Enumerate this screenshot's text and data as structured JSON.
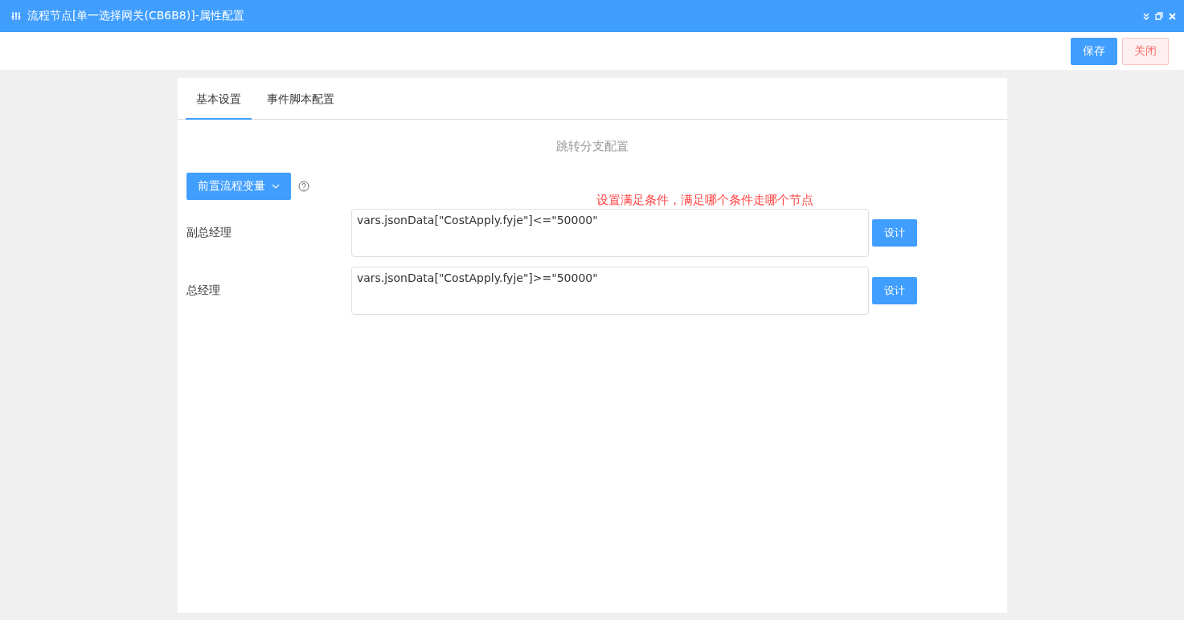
{
  "window": {
    "title": "流程节点[单一选择网关(CB6B8)]-属性配置"
  },
  "toolbar": {
    "buttons": [
      {
        "label": "保存",
        "kind": "primary"
      },
      {
        "label": "关闭",
        "kind": "danger"
      }
    ]
  },
  "tabs": [
    {
      "label": "基本设置",
      "selected": true
    },
    {
      "label": "事件脚本配置",
      "selected": false
    }
  ],
  "section_title": "跳转分支配置",
  "variables_button": "前置流程变量",
  "annotation": "设置满足条件，满足哪个条件走哪个节点",
  "branches": [
    {
      "label": "副总经理",
      "condition": "vars.jsonData[\"CostApply.fyje\"]<=\"50000\"",
      "button": "设计"
    },
    {
      "label": "总经理",
      "condition": "vars.jsonData[\"CostApply.fyje\"]>=\"50000\"",
      "button": "设计"
    }
  ]
}
